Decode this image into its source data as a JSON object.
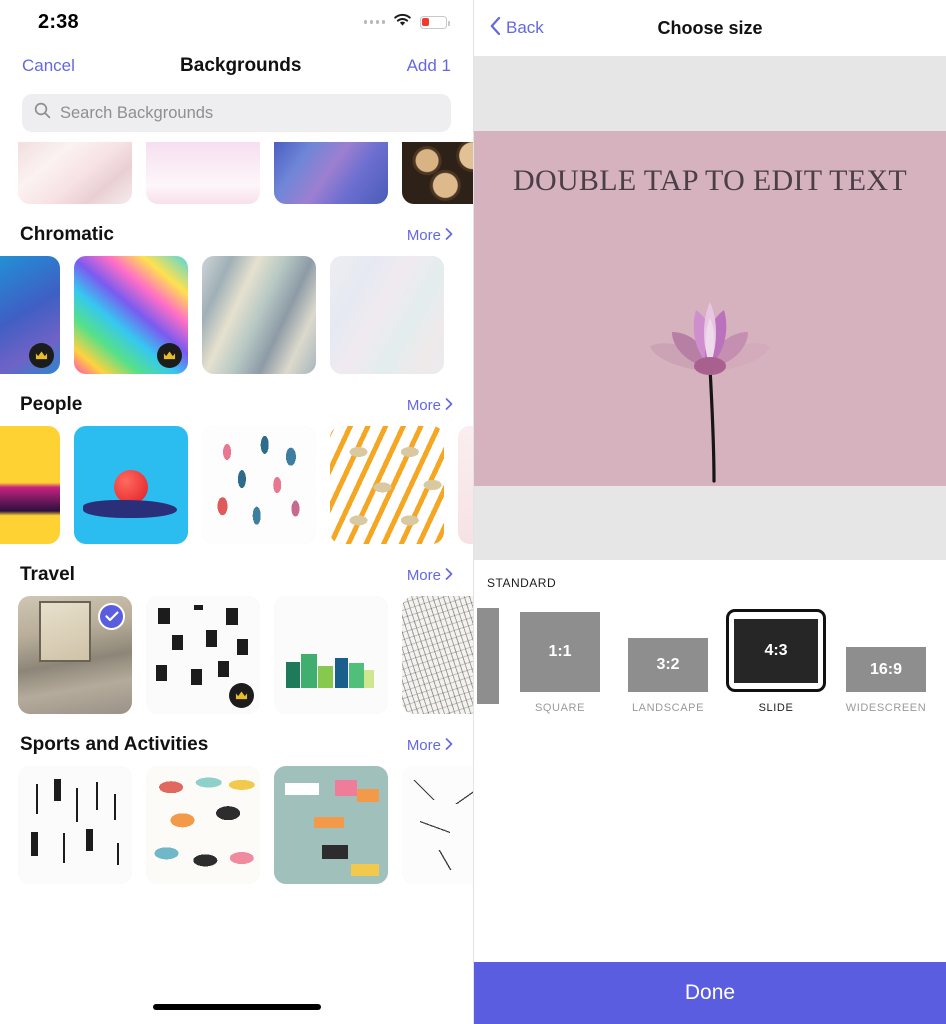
{
  "status_bar": {
    "time": "2:38",
    "signal_icon": "signal-dots-icon",
    "wifi_icon": "wifi-icon",
    "battery_icon": "battery-low-icon"
  },
  "left_panel": {
    "nav": {
      "cancel_label": "Cancel",
      "title": "Backgrounds",
      "add_label": "Add 1"
    },
    "search": {
      "placeholder": "Search Backgrounds",
      "value": "",
      "icon": "search-icon"
    },
    "more_label": "More",
    "sections": [
      {
        "title": "",
        "partial_top_row": true,
        "items": [
          {
            "name": "pink-marble-texture",
            "badge": "none"
          },
          {
            "name": "pink-watercolor-wash",
            "badge": "none"
          },
          {
            "name": "blue-purple-marble",
            "badge": "none"
          },
          {
            "name": "stacked-logs-photo",
            "badge": "none"
          }
        ]
      },
      {
        "title": "Chromatic",
        "items": [
          {
            "name": "blue-gradient-chrome",
            "badge": "crown"
          },
          {
            "name": "rainbow-holographic-foil",
            "badge": "crown"
          },
          {
            "name": "silver-iridescent-foil",
            "badge": "none"
          },
          {
            "name": "pale-holographic-swirl",
            "badge": "none"
          }
        ]
      },
      {
        "title": "People",
        "items": [
          {
            "name": "yellow-magenta-hand",
            "badge": "none"
          },
          {
            "name": "blue-hand-red-ball",
            "badge": "none"
          },
          {
            "name": "illustrated-people-pattern",
            "badge": "none"
          },
          {
            "name": "eye-lightning-pattern",
            "badge": "none"
          },
          {
            "name": "pale-pink-edge",
            "badge": "none"
          }
        ]
      },
      {
        "title": "Travel",
        "items": [
          {
            "name": "bedroom-window-photo",
            "badge": "check"
          },
          {
            "name": "black-houses-pattern",
            "badge": "crown"
          },
          {
            "name": "green-city-illustration",
            "badge": "none"
          },
          {
            "name": "vintage-map-engraving",
            "badge": "none"
          }
        ]
      },
      {
        "title": "Sports and Activities",
        "items": [
          {
            "name": "arrows-feathers-pattern",
            "badge": "none"
          },
          {
            "name": "yoga-poses-illustration",
            "badge": "none"
          },
          {
            "name": "yoga-breathing-teal-poster",
            "badge": "none"
          },
          {
            "name": "scattered-arrows-pattern",
            "badge": "none"
          }
        ]
      }
    ],
    "home_indicator": "home-indicator"
  },
  "right_panel": {
    "nav": {
      "back_label": "Back",
      "back_icon": "chevron-left-icon",
      "title": "Choose size"
    },
    "preview": {
      "slide_text": "DOUBLE TAP TO EDIT TEXT",
      "background_color": "#d6b2bf",
      "text_color": "#4a3f44",
      "canvas_color": "#e6e6e6",
      "graphic": "lotus-flower-image"
    },
    "size_picker": {
      "group_label": "STANDARD",
      "selected": "4:3",
      "options": [
        {
          "ratio": "",
          "caption": "",
          "partial": true,
          "w": 22,
          "h": 96
        },
        {
          "ratio": "1:1",
          "caption": "SQUARE",
          "w": 80,
          "h": 80
        },
        {
          "ratio": "3:2",
          "caption": "LANDSCAPE",
          "w": 80,
          "h": 54
        },
        {
          "ratio": "4:3",
          "caption": "SLIDE",
          "w": 94,
          "h": 70
        },
        {
          "ratio": "16:9",
          "caption": "WIDESCREEN",
          "w": 80,
          "h": 45
        }
      ]
    },
    "done_button": {
      "label": "Done",
      "color": "#5a5de0"
    }
  }
}
